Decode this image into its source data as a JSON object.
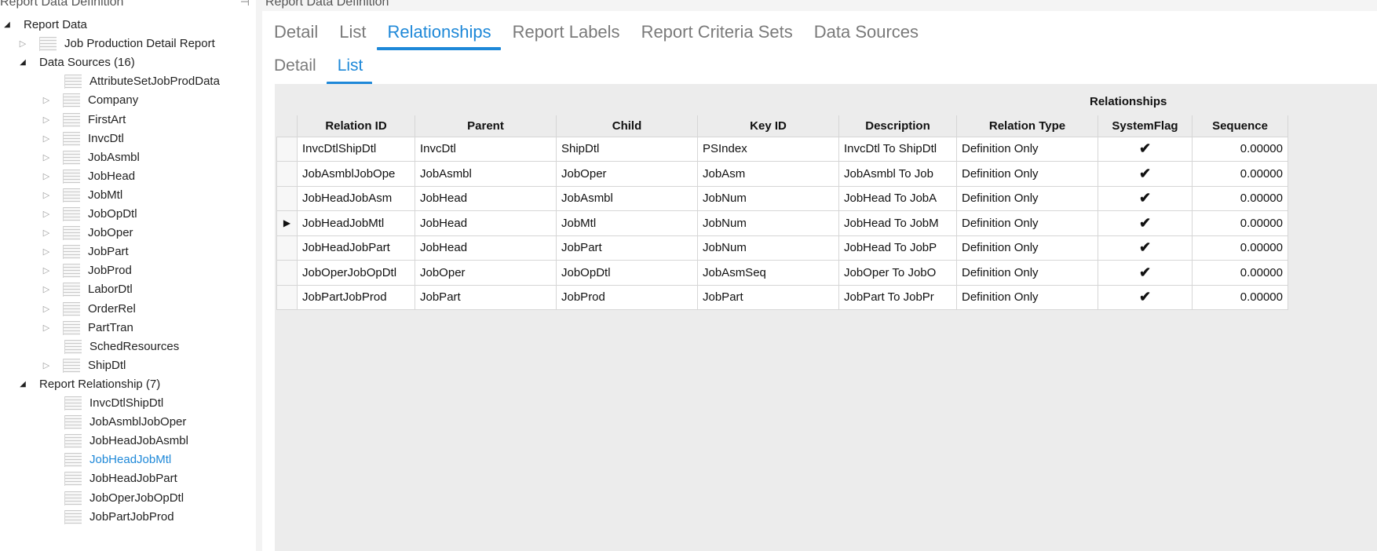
{
  "left_panel": {
    "title": "Report Data Definition",
    "pin_icon": "pin-icon",
    "tree": [
      {
        "label": "Report Data",
        "level": 0,
        "expander": "open",
        "icon": false
      },
      {
        "label": "Job Production Detail Report",
        "level": 1,
        "expander": "closed",
        "icon": true
      },
      {
        "label": "Data Sources (16)",
        "level": 1,
        "expander": "open",
        "icon": false
      },
      {
        "label": "AttributeSetJobProdData",
        "level": 2,
        "expander": "none",
        "icon": true
      },
      {
        "label": "Company",
        "level": 2,
        "expander": "closed",
        "icon": true
      },
      {
        "label": "FirstArt",
        "level": 2,
        "expander": "closed",
        "icon": true
      },
      {
        "label": "InvcDtl",
        "level": 2,
        "expander": "closed",
        "icon": true
      },
      {
        "label": "JobAsmbl",
        "level": 2,
        "expander": "closed",
        "icon": true
      },
      {
        "label": "JobHead",
        "level": 2,
        "expander": "closed",
        "icon": true
      },
      {
        "label": "JobMtl",
        "level": 2,
        "expander": "closed",
        "icon": true
      },
      {
        "label": "JobOpDtl",
        "level": 2,
        "expander": "closed",
        "icon": true
      },
      {
        "label": "JobOper",
        "level": 2,
        "expander": "closed",
        "icon": true
      },
      {
        "label": "JobPart",
        "level": 2,
        "expander": "closed",
        "icon": true
      },
      {
        "label": "JobProd",
        "level": 2,
        "expander": "closed",
        "icon": true
      },
      {
        "label": "LaborDtl",
        "level": 2,
        "expander": "closed",
        "icon": true
      },
      {
        "label": "OrderRel",
        "level": 2,
        "expander": "closed",
        "icon": true
      },
      {
        "label": "PartTran",
        "level": 2,
        "expander": "closed",
        "icon": true
      },
      {
        "label": "SchedResources",
        "level": 2,
        "expander": "none",
        "icon": true
      },
      {
        "label": "ShipDtl",
        "level": 2,
        "expander": "closed",
        "icon": true
      },
      {
        "label": "Report Relationship (7)",
        "level": 1,
        "expander": "open",
        "icon": false
      },
      {
        "label": "InvcDtlShipDtl",
        "level": 2,
        "expander": "none",
        "icon": true
      },
      {
        "label": "JobAsmblJobOper",
        "level": 2,
        "expander": "none",
        "icon": true
      },
      {
        "label": "JobHeadJobAsmbl",
        "level": 2,
        "expander": "none",
        "icon": true
      },
      {
        "label": "JobHeadJobMtl",
        "level": 2,
        "expander": "none",
        "icon": true,
        "selected": true
      },
      {
        "label": "JobHeadJobPart",
        "level": 2,
        "expander": "none",
        "icon": true
      },
      {
        "label": "JobOperJobOpDtl",
        "level": 2,
        "expander": "none",
        "icon": true
      },
      {
        "label": "JobPartJobProd",
        "level": 2,
        "expander": "none",
        "icon": true
      }
    ]
  },
  "right_panel": {
    "title": "Report Data Definition",
    "primary_tabs": [
      {
        "label": "Detail",
        "active": false
      },
      {
        "label": "List",
        "active": false
      },
      {
        "label": "Relationships",
        "active": true
      },
      {
        "label": "Report Labels",
        "active": false
      },
      {
        "label": "Report Criteria Sets",
        "active": false
      },
      {
        "label": "Data Sources",
        "active": false
      }
    ],
    "secondary_tabs": [
      {
        "label": "Detail",
        "active": false
      },
      {
        "label": "List",
        "active": true
      }
    ],
    "grid": {
      "group_header": "Relationships",
      "columns": [
        "Relation ID",
        "Parent",
        "Child",
        "Key ID",
        "Description",
        "Relation Type",
        "SystemFlag",
        "Sequence"
      ],
      "current_row_marker": "▶",
      "rows": [
        {
          "relation_id": "InvcDtlShipDtl",
          "parent": "InvcDtl",
          "child": "ShipDtl",
          "key_id": "PSIndex",
          "description": "InvcDtl To ShipDtl",
          "relation_type": "Definition Only",
          "system_flag": true,
          "sequence": "0.00000",
          "current": false
        },
        {
          "relation_id": "JobAsmblJobOpe",
          "parent": "JobAsmbl",
          "child": "JobOper",
          "key_id": "JobAsm",
          "description": "JobAsmbl To Job",
          "relation_type": "Definition Only",
          "system_flag": true,
          "sequence": "0.00000",
          "current": false
        },
        {
          "relation_id": "JobHeadJobAsm",
          "parent": "JobHead",
          "child": "JobAsmbl",
          "key_id": "JobNum",
          "description": "JobHead To JobA",
          "relation_type": "Definition Only",
          "system_flag": true,
          "sequence": "0.00000",
          "current": false
        },
        {
          "relation_id": "JobHeadJobMtl",
          "parent": "JobHead",
          "child": "JobMtl",
          "key_id": "JobNum",
          "description": "JobHead To JobM",
          "relation_type": "Definition Only",
          "system_flag": true,
          "sequence": "0.00000",
          "current": true
        },
        {
          "relation_id": "JobHeadJobPart",
          "parent": "JobHead",
          "child": "JobPart",
          "key_id": "JobNum",
          "description": "JobHead To JobP",
          "relation_type": "Definition Only",
          "system_flag": true,
          "sequence": "0.00000",
          "current": false
        },
        {
          "relation_id": "JobOperJobOpDtl",
          "parent": "JobOper",
          "child": "JobOpDtl",
          "key_id": "JobAsmSeq",
          "description": "JobOper To JobO",
          "relation_type": "Definition Only",
          "system_flag": true,
          "sequence": "0.00000",
          "current": false
        },
        {
          "relation_id": "JobPartJobProd",
          "parent": "JobPart",
          "child": "JobProd",
          "key_id": "JobPart",
          "description": "JobPart To JobPr",
          "relation_type": "Definition Only",
          "system_flag": true,
          "sequence": "0.00000",
          "current": false
        }
      ]
    }
  },
  "colors": {
    "accent": "#1e88d8",
    "grid_background": "#ececec"
  }
}
